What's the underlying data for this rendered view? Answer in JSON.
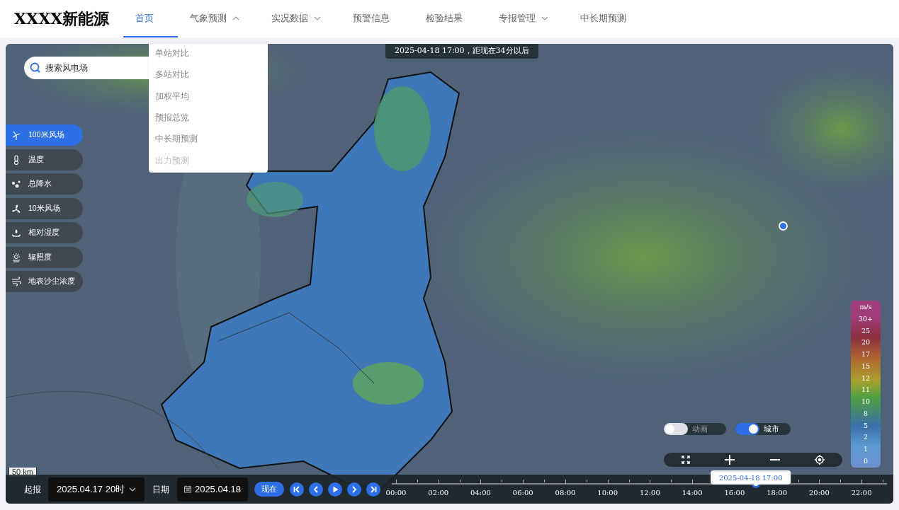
{
  "header": {
    "logo": "XXXX新能源",
    "nav": [
      {
        "label": "首页",
        "selected": true
      },
      {
        "label": "气象预测",
        "selected": false,
        "expanded": true
      },
      {
        "label": "实况数据",
        "selected": false,
        "expanded": false
      },
      {
        "label": "预警信息",
        "selected": false
      },
      {
        "label": "检验结果",
        "selected": false
      },
      {
        "label": "专报管理",
        "selected": false,
        "expanded": false
      },
      {
        "label": "中长期预测",
        "selected": false
      }
    ]
  },
  "dropdown": [
    {
      "label": "单站对比",
      "disabled": false
    },
    {
      "label": "多站对比",
      "disabled": false
    },
    {
      "label": "加权平均",
      "disabled": false
    },
    {
      "label": "预报总览",
      "disabled": false
    },
    {
      "label": "中长期预测",
      "disabled": false
    },
    {
      "label": "出力预测",
      "disabled": true
    }
  ],
  "search": {
    "placeholder": "搜索风电场"
  },
  "time_banner": "2025-04-18  17:00，距现在34分以后",
  "layers": [
    {
      "label": "100米风场",
      "kind": "turbine",
      "selected": true
    },
    {
      "label": "温度",
      "kind": "thermometer",
      "selected": false
    },
    {
      "label": "总降水",
      "kind": "drops",
      "selected": false
    },
    {
      "label": "10米风场",
      "kind": "fan",
      "selected": false
    },
    {
      "label": "相对湿度",
      "kind": "humidity",
      "selected": false
    },
    {
      "label": "辐照度",
      "kind": "sun",
      "selected": false
    },
    {
      "label": "地表沙尘浓度",
      "kind": "wind",
      "selected": false
    }
  ],
  "legend": {
    "unit": "m/s",
    "labels": [
      "30+",
      "25",
      "20",
      "17",
      "15",
      "12",
      "11",
      "10",
      "8",
      "5",
      "2",
      "1",
      "0"
    ]
  },
  "toggles": [
    {
      "label": "动画",
      "on": false
    },
    {
      "label": "城市",
      "on": true
    }
  ],
  "scale": "50 km",
  "timeline": {
    "issue_label": "起报",
    "issue_value": "2025.04.17 20时",
    "date_label": "日期",
    "date_value": "2025.04.18",
    "now_button": "现在",
    "ticks": [
      "00:00",
      "02:00",
      "04:00",
      "06:00",
      "08:00",
      "10:00",
      "12:00",
      "14:00",
      "16:00",
      "18:00",
      "20:00",
      "22:00"
    ],
    "level": 0.739,
    "current": "2025-04-18 17:00"
  }
}
